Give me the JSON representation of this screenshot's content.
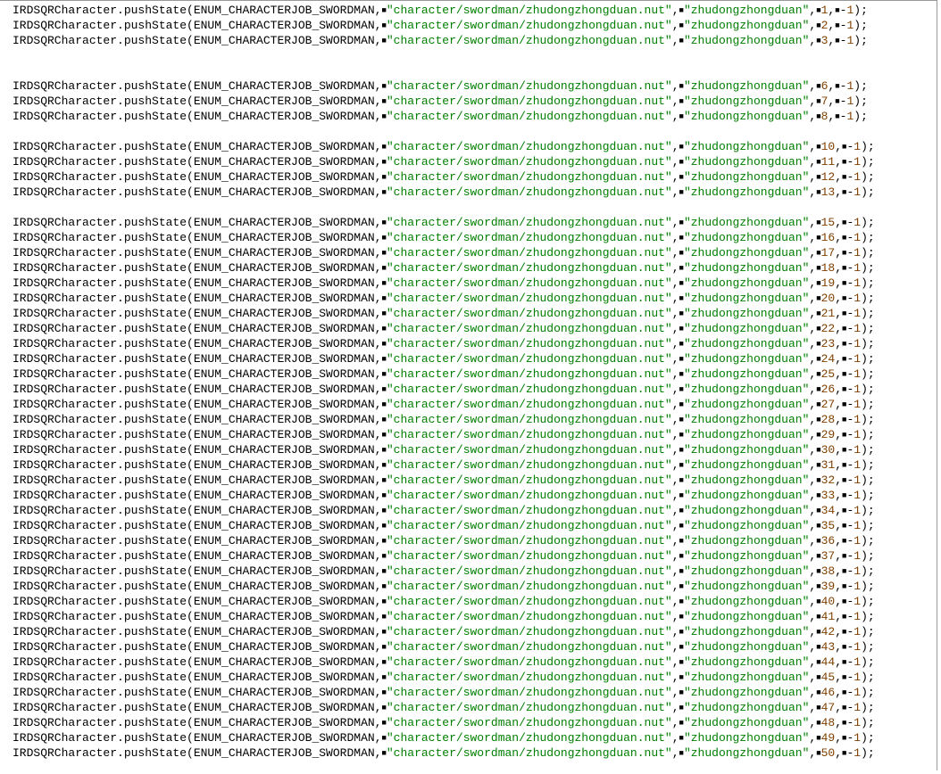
{
  "code": {
    "object": "IRDSQRCharacter",
    "method": "pushState",
    "enum": "ENUM_CHARACTERJOB_SWORDMAN",
    "path_literal": "\"character/swordman/zhudongzhongduan.nut\"",
    "name_literal": "\"zhudongzhongduan\"",
    "final_arg": "-1",
    "groups": [
      {
        "ids": [
          1,
          2,
          3
        ]
      },
      {
        "ids": [
          6,
          7,
          8
        ]
      },
      {
        "ids": [
          10,
          11,
          12,
          13
        ]
      },
      {
        "ids": [
          15,
          16,
          17,
          18,
          19,
          20,
          21,
          22,
          23,
          24,
          25,
          26,
          27,
          28,
          29,
          30,
          31,
          32,
          33,
          34,
          35,
          36,
          37,
          38,
          39,
          40,
          41,
          42,
          43,
          44,
          45,
          46,
          47,
          48,
          49,
          50
        ]
      }
    ]
  }
}
